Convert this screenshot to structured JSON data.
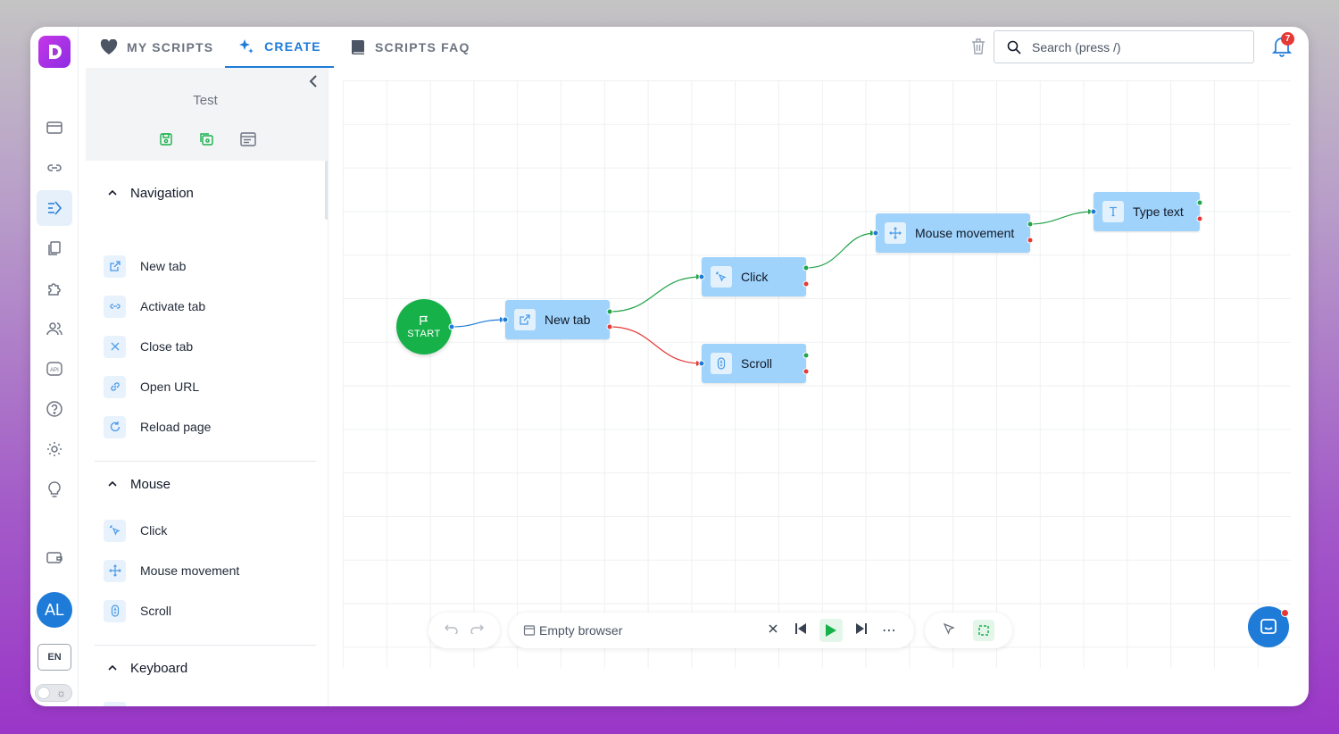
{
  "tabs": [
    {
      "label": "MY SCRIPTS",
      "icon": "heart-icon"
    },
    {
      "label": "CREATE",
      "icon": "sparkle-icon"
    },
    {
      "label": "SCRIPTS FAQ",
      "icon": "book-icon"
    }
  ],
  "search": {
    "placeholder": "Search (press /)"
  },
  "notifications": {
    "count": "7"
  },
  "script": {
    "name": "Test"
  },
  "sidebar": {
    "sections": [
      {
        "title": "Navigation",
        "items": [
          "New tab",
          "Activate tab",
          "Close tab",
          "Open URL",
          "Reload page"
        ]
      },
      {
        "title": "Mouse",
        "items": [
          "Click",
          "Mouse movement",
          "Scroll"
        ]
      },
      {
        "title": "Keyboard",
        "items": []
      }
    ]
  },
  "user": {
    "initials": "AL"
  },
  "language": "EN",
  "flow": {
    "start_label": "START",
    "nodes": [
      "New tab",
      "Click",
      "Scroll",
      "Mouse movement",
      "Type text"
    ]
  },
  "toolbar": {
    "browser_label": "Empty browser"
  },
  "colors": {
    "accent": "#1e7bd8",
    "node": "#9fd3fb",
    "start": "#17b14a",
    "success_edge": "#22a34a",
    "error_edge": "#e53935"
  }
}
